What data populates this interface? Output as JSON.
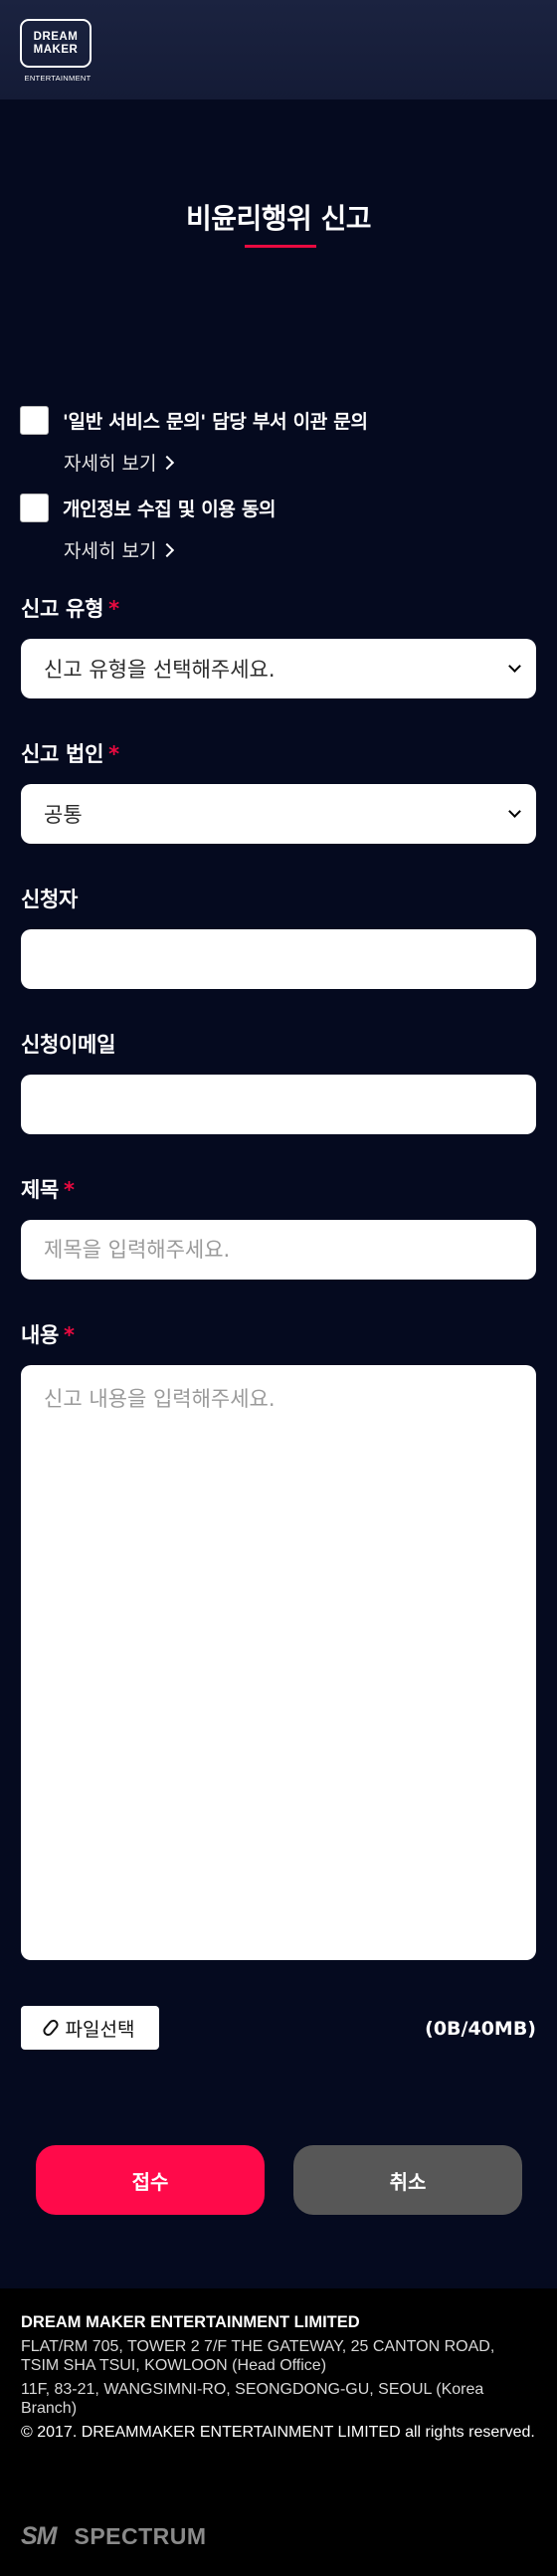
{
  "header": {
    "logo_line1": "DREAM",
    "logo_line2": "MAKER",
    "logo_sub": "ENTERTAINMENT"
  },
  "page_title": "비윤리행위 신고",
  "agreements": [
    {
      "label": "'일반 서비스 문의' 담당 부서 이관 문의",
      "more": "자세히 보기",
      "checked": false
    },
    {
      "label": "개인정보 수집 및 이용 동의",
      "more": "자세히 보기",
      "checked": false
    }
  ],
  "form": {
    "report_type": {
      "label": "신고 유형",
      "required_mark": "*",
      "value": "신고 유형을 선택해주세요."
    },
    "company": {
      "label": "신고 법인",
      "required_mark": "*",
      "value": "공통"
    },
    "applicant": {
      "label": "신청자",
      "value": ""
    },
    "email": {
      "label": "신청이메일",
      "value": ""
    },
    "subject": {
      "label": "제목",
      "required_mark": "*",
      "placeholder": "제목을 입력해주세요."
    },
    "content": {
      "label": "내용",
      "required_mark": "*",
      "placeholder": "신고 내용을 입력해주세요."
    }
  },
  "file": {
    "button_label": "파일선택",
    "size": "(0B/40MB)"
  },
  "actions": {
    "submit": "접수",
    "cancel": "취소"
  },
  "colors": {
    "accent": "#ff0a4a",
    "background": "#050a1f",
    "cancel": "#575757"
  },
  "footer": {
    "company": "DREAM MAKER ENTERTAINMENT LIMITED",
    "address_head": "FLAT/RM 705, TOWER 2 7/F THE GATEWAY, 25 CANTON ROAD, TSIM SHA TSUI, KOWLOON (Head Office)",
    "address_branch": "11F, 83-21, WANGSIMNI-RO, SEONGDONG-GU, SEOUL (Korea Branch)",
    "copyright": "© 2017. DREAMMAKER ENTERTAINMENT LIMITED all rights reserved.",
    "sponsor_1": "SM",
    "sponsor_2": "SPECTRUM"
  }
}
